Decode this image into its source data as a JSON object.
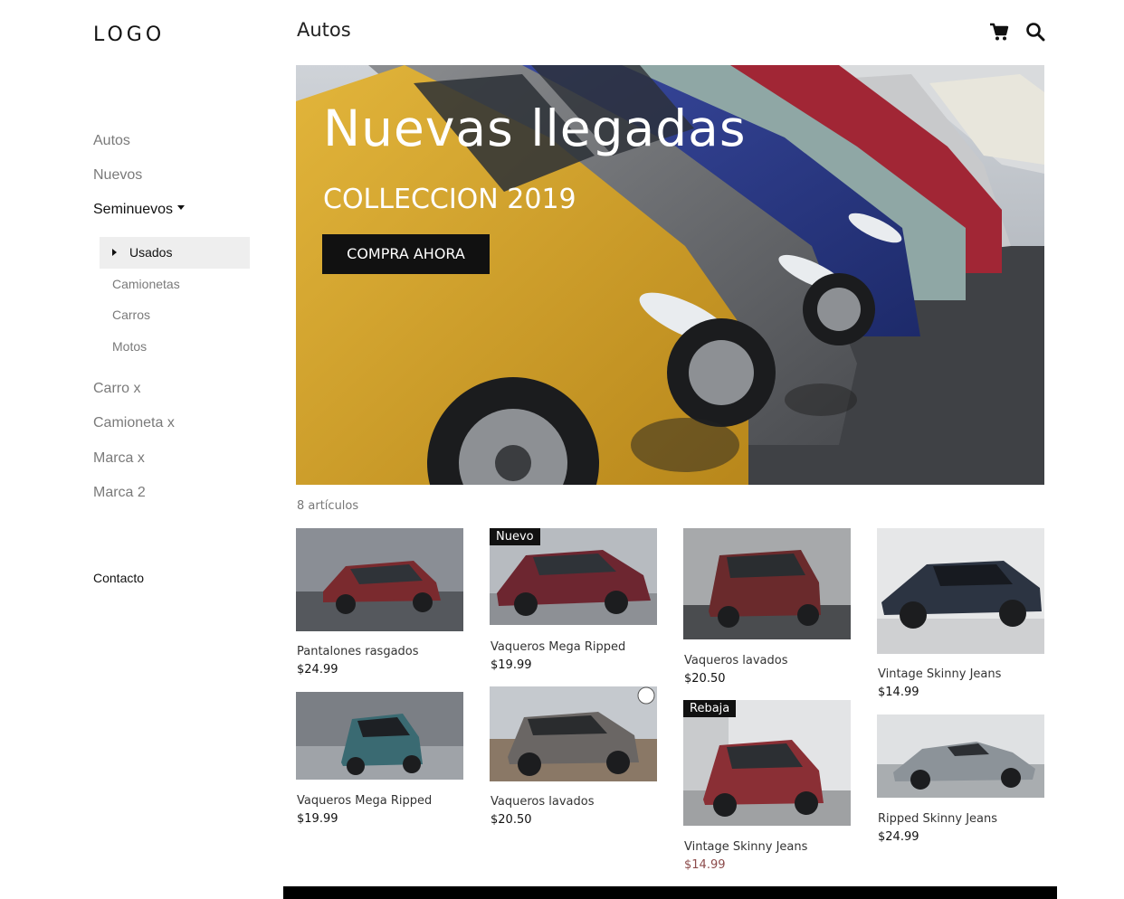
{
  "logo": "LOGO",
  "header": {
    "title": "Autos"
  },
  "nav": {
    "items": [
      "Autos",
      "Nuevos",
      "Seminuevos",
      "Carro x",
      "Camioneta x",
      "Marca x",
      "Marca 2"
    ],
    "sub_selected": "Usados",
    "sub_items": [
      "Camionetas",
      "Carros",
      "Motos"
    ],
    "contact": "Contacto"
  },
  "hero": {
    "title": "Nuevas llegadas",
    "subtitle": "COLLECCION 2019",
    "button": "COMPRA AHORA"
  },
  "listing": {
    "count": "8 artículos",
    "products": [
      {
        "name": "Pantalones rasgados",
        "price": "$24.99"
      },
      {
        "name": "Vaqueros Mega Ripped",
        "price": "$19.99",
        "badge": "Nuevo"
      },
      {
        "name": "Vaqueros lavados",
        "price": "$20.50"
      },
      {
        "name": "Vintage Skinny Jeans",
        "price": "$14.99"
      },
      {
        "name": "Vaqueros Mega Ripped",
        "price": "$19.99"
      },
      {
        "name": "Vaqueros lavados",
        "price": "$20.50"
      },
      {
        "name": "Vintage Skinny Jeans",
        "price": "$14.99",
        "badge": "Rebaja"
      },
      {
        "name": "Ripped Skinny Jeans",
        "price": "$24.99"
      }
    ]
  },
  "colors": {
    "sale_price": "#8c4b4b",
    "badge_bg": "#111111"
  },
  "icons": [
    "cart-icon",
    "search-icon"
  ]
}
